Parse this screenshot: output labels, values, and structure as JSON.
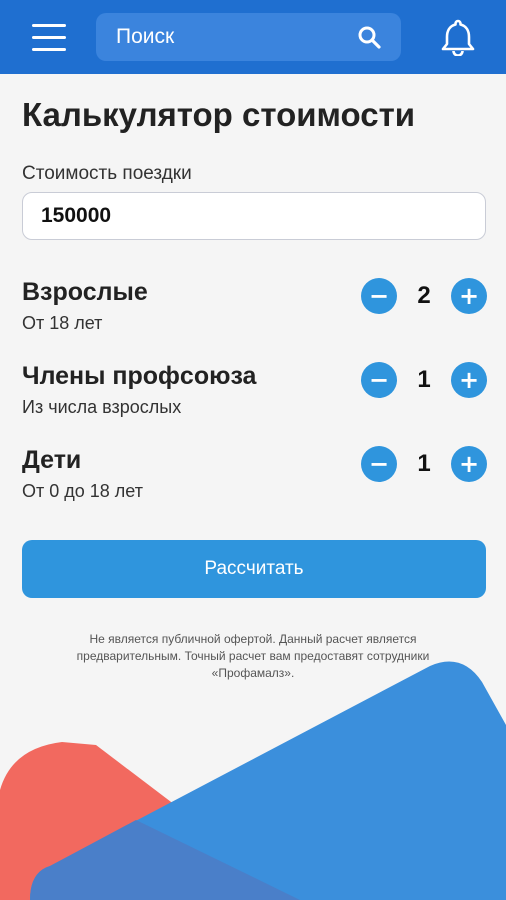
{
  "header": {
    "search_placeholder": "Поиск",
    "menu_icon": "hamburger-menu-icon",
    "search_icon": "search-icon",
    "notification_icon": "bell-icon"
  },
  "main": {
    "title": "Калькулятор стоимости",
    "trip_cost": {
      "label": "Стоимость поездки",
      "value": "150000"
    },
    "travelers": [
      {
        "title": "Взрослые",
        "subtitle": "От 18 лет",
        "count": "2"
      },
      {
        "title": "Члены профсоюза",
        "subtitle": "Из числа взрослых",
        "count": "1"
      },
      {
        "title": "Дети",
        "subtitle": "От 0 до 18 лет",
        "count": "1"
      }
    ],
    "stepper": {
      "minus": "−",
      "plus": "+"
    },
    "calculate_label": "Рассчитать",
    "disclaimer": "Не является публичной офертой. Данный расчет является предварительным. Точный расчет вам предоставят сотрудники «Профамалз»."
  },
  "colors": {
    "header": "#1f6fd0",
    "accent": "#2f95dd",
    "decor_red": "#f2695f",
    "decor_blue": "#3b8fdc"
  }
}
